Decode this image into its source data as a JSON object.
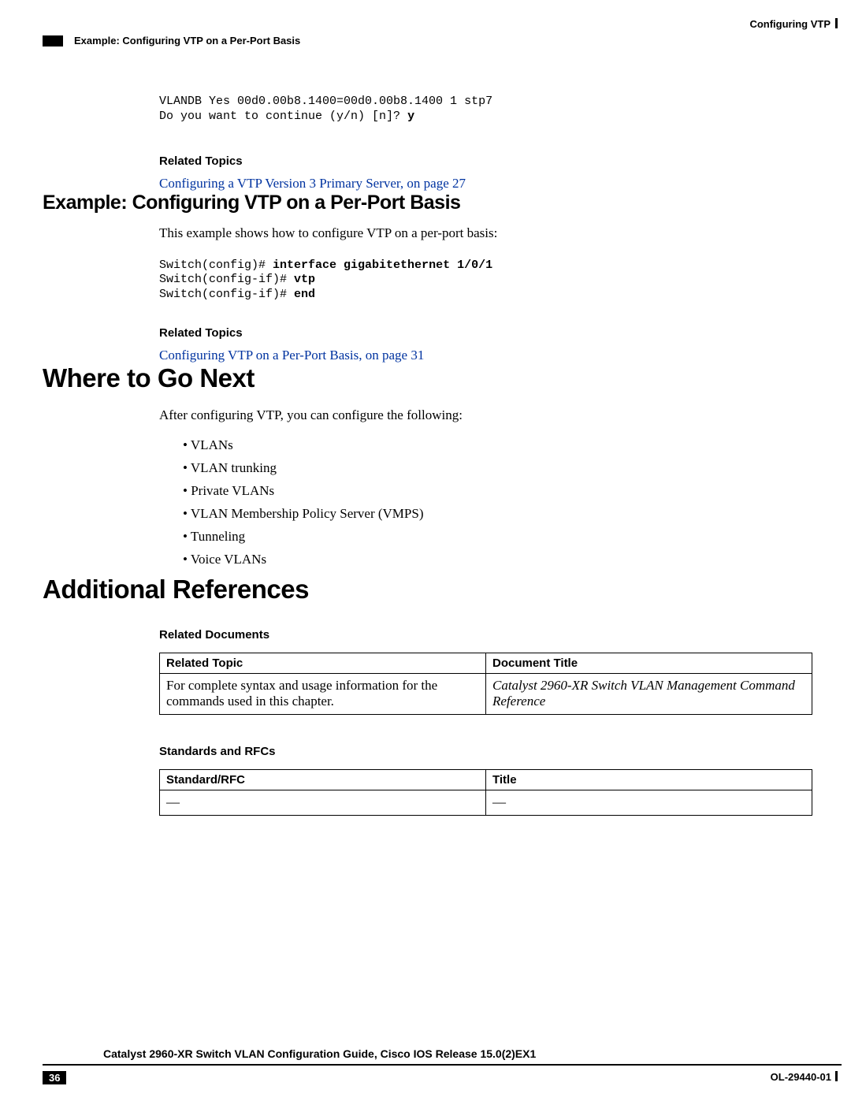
{
  "header": {
    "chapter": "Configuring VTP",
    "breadcrumb": "Example: Configuring VTP on a Per-Port Basis"
  },
  "code1": {
    "line1": "VLANDB Yes 00d0.00b8.1400=00d0.00b8.1400 1 stp7",
    "line2a": "Do you want to continue (y/n) [n]? ",
    "line2b": "y"
  },
  "related_topics_label": "Related Topics",
  "link1": "Configuring a VTP Version 3 Primary Server,  on page 27",
  "h2_example": "Example: Configuring VTP on a Per-Port Basis",
  "example_intro": "This example shows how to configure VTP on a per-port basis:",
  "code2": {
    "l1a": "Switch(config)# ",
    "l1b": "interface gigabitethernet 1/0/1",
    "l2a": "Switch(config-if)# ",
    "l2b": "vtp",
    "l3a": "Switch(config-if)# ",
    "l3b": "end"
  },
  "link2": "Configuring VTP on a Per-Port Basis,  on page 31",
  "h1_where": "Where to Go Next",
  "where_intro": "After configuring VTP, you can configure the following:",
  "where_list": [
    "VLANs",
    "VLAN trunking",
    "Private VLANs",
    "VLAN Membership Policy Server (VMPS)",
    "Tunneling",
    "Voice VLANs"
  ],
  "h1_refs": "Additional References",
  "related_docs_label": "Related Documents",
  "table1": {
    "h1": "Related Topic",
    "h2": "Document Title",
    "r1c1": "For complete syntax and usage information for the commands used in this chapter.",
    "r1c2": "Catalyst 2960-XR Switch VLAN Management Command Reference"
  },
  "standards_label": "Standards and RFCs",
  "table2": {
    "h1": "Standard/RFC",
    "h2": "Title",
    "r1c1": "—",
    "r1c2": "—"
  },
  "footer": {
    "title": "Catalyst 2960-XR Switch VLAN Configuration Guide, Cisco IOS Release 15.0(2)EX1",
    "page": "36",
    "docid": "OL-29440-01"
  }
}
